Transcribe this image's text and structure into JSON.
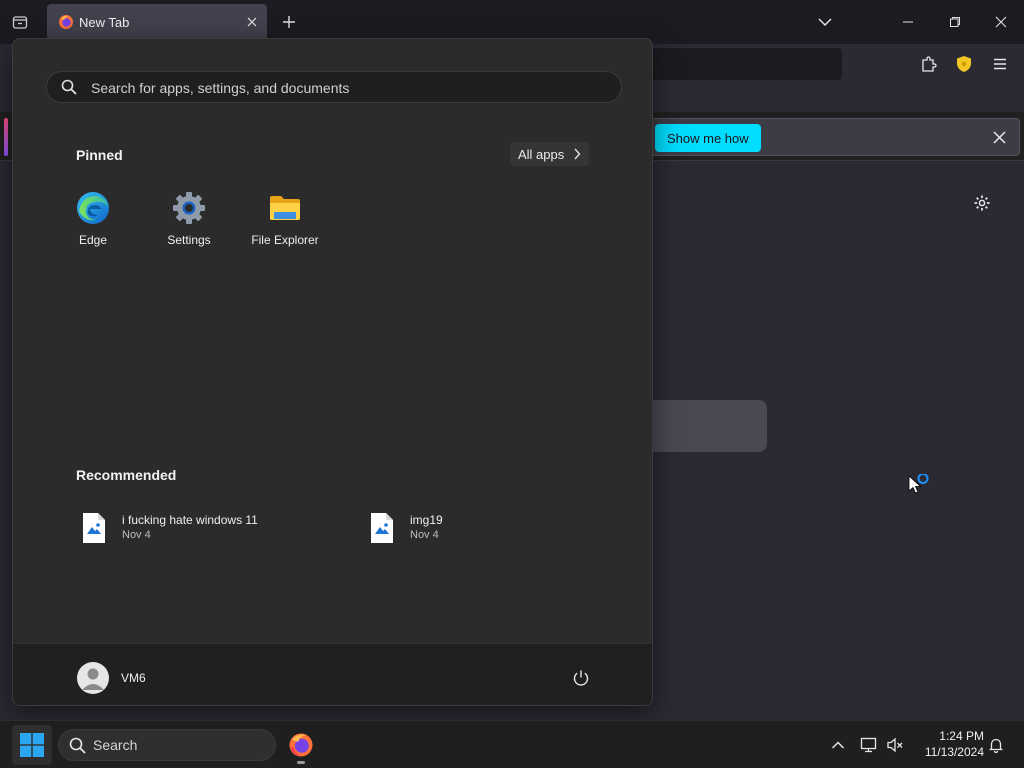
{
  "browser": {
    "tab_title": "New Tab",
    "notice_button": "Show me how"
  },
  "start_menu": {
    "search_placeholder": "Search for apps, settings, and documents",
    "pinned_title": "Pinned",
    "all_apps_label": "All apps",
    "pinned": [
      {
        "label": "Edge",
        "icon": "edge-icon"
      },
      {
        "label": "Settings",
        "icon": "settings-icon"
      },
      {
        "label": "File Explorer",
        "icon": "folder-icon"
      }
    ],
    "recommended_title": "Recommended",
    "recommended": [
      {
        "name": "i fucking hate windows 11",
        "date": "Nov 4",
        "icon": "image-file-icon"
      },
      {
        "name": "img19",
        "date": "Nov 4",
        "icon": "image-file-icon"
      }
    ],
    "user_name": "VM6"
  },
  "taskbar": {
    "search_label": "Search",
    "time": "1:24 PM",
    "date": "11/13/2024"
  },
  "colors": {
    "accent_cyan": "#00ddff",
    "start_blue": "#2aa7f0",
    "menu_bg": "#2b2b2b",
    "taskbar_bg": "#1f1f1f"
  }
}
